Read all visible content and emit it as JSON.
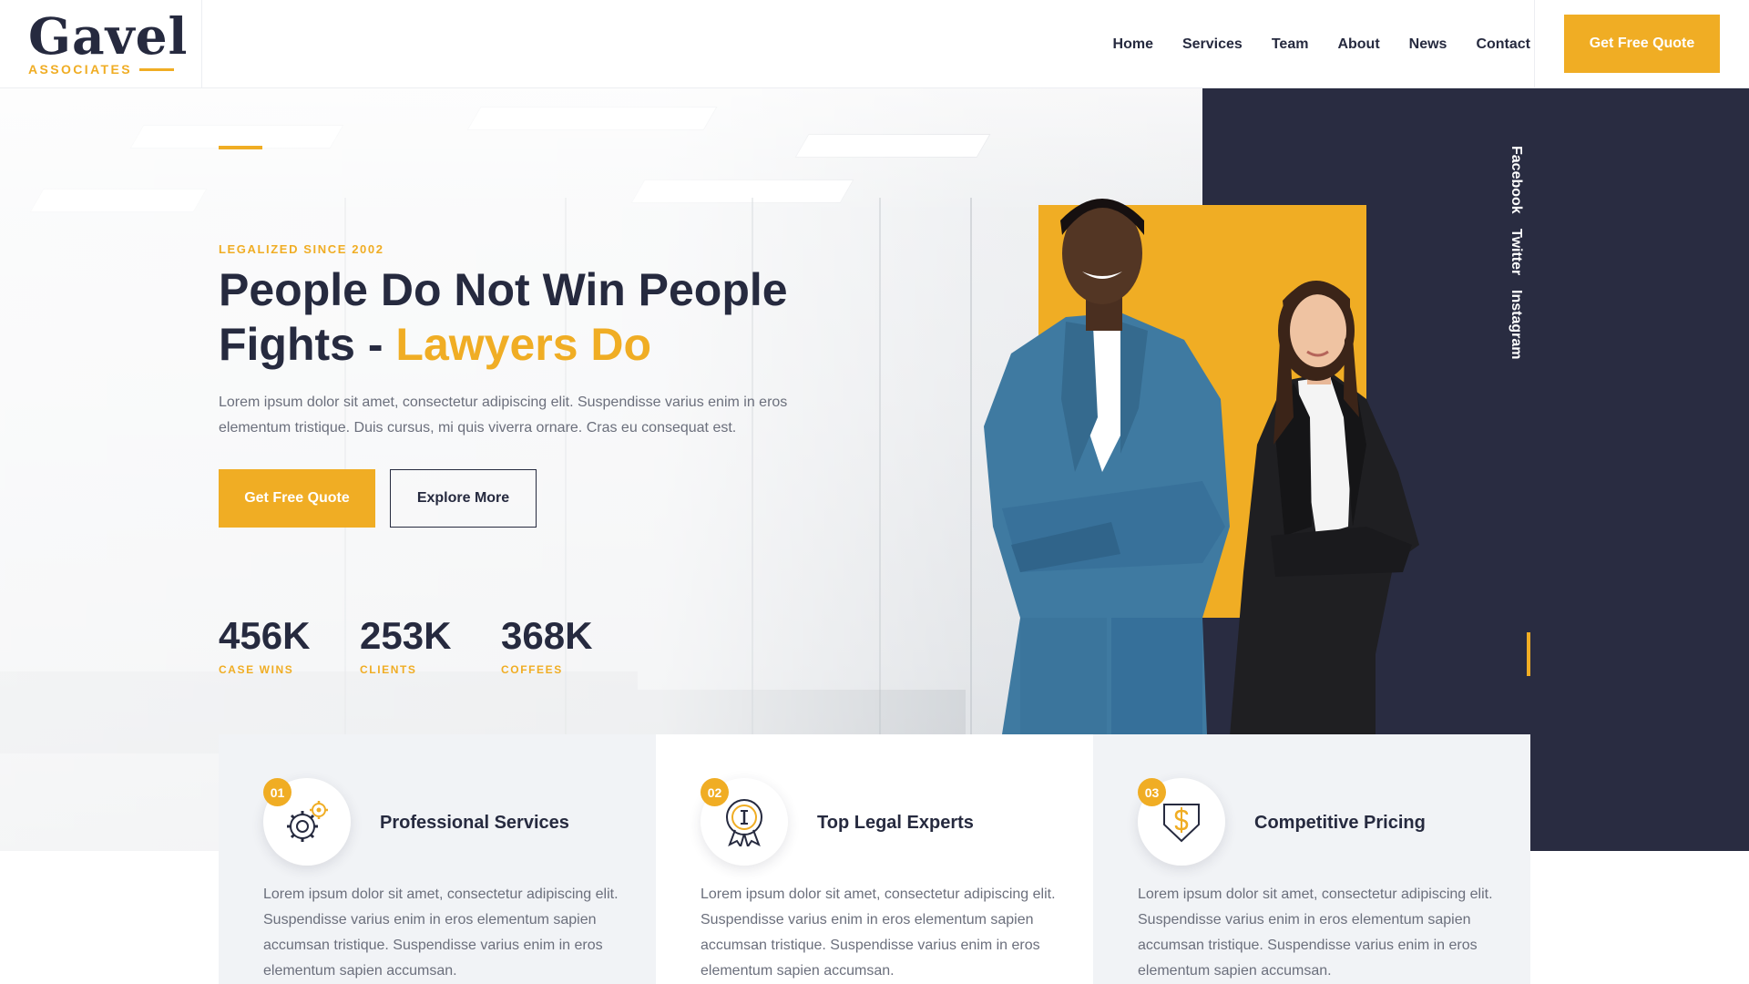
{
  "brand": {
    "logo_word": "Gavel",
    "logo_sub": "ASSOCIATES",
    "accent_color": "#f0ad24",
    "dark_color": "#262a3f",
    "panel_color": "#292c41"
  },
  "nav": {
    "items": [
      {
        "label": "Home"
      },
      {
        "label": "Services"
      },
      {
        "label": "Team"
      },
      {
        "label": "About"
      },
      {
        "label": "News"
      },
      {
        "label": "Contact"
      }
    ],
    "cta_label": "Get Free Quote"
  },
  "hero": {
    "eyebrow": "LEGALIZED SINCE 2002",
    "title_part1": "People Do Not Win People Fights - ",
    "title_highlight": "Lawyers Do",
    "description": "Lorem ipsum dolor sit amet, consectetur adipiscing elit. Suspendisse varius enim in eros elementum tristique. Duis cursus, mi quis viverra ornare. Cras eu consequat est.",
    "primary_button": "Get Free Quote",
    "secondary_button": "Explore More",
    "stats": [
      {
        "value": "456K",
        "label": "CASE WINS"
      },
      {
        "value": "253K",
        "label": "CLIENTS"
      },
      {
        "value": "368K",
        "label": "COFFEES"
      }
    ]
  },
  "social": {
    "links": [
      {
        "label": "Facebook"
      },
      {
        "label": "Twitter"
      },
      {
        "label": "Instagram"
      }
    ]
  },
  "features": [
    {
      "number": "01",
      "title": "Professional Services",
      "icon": "gear-settings-icon",
      "description": "Lorem ipsum dolor sit amet, consectetur adipiscing elit. Suspendisse varius enim in eros elementum sapien accumsan tristique. Suspendisse varius enim in eros elementum sapien accumsan."
    },
    {
      "number": "02",
      "title": "Top Legal Experts",
      "icon": "award-medal-icon",
      "description": "Lorem ipsum dolor sit amet, consectetur adipiscing elit. Suspendisse varius enim in eros elementum sapien accumsan tristique. Suspendisse varius enim in eros elementum sapien accumsan."
    },
    {
      "number": "03",
      "title": "Competitive Pricing",
      "icon": "price-tag-dollar-icon",
      "description": "Lorem ipsum dolor sit amet, consectetur adipiscing elit. Suspendisse varius enim in eros elementum sapien accumsan tristique. Suspendisse varius enim in eros elementum sapien accumsan."
    }
  ]
}
